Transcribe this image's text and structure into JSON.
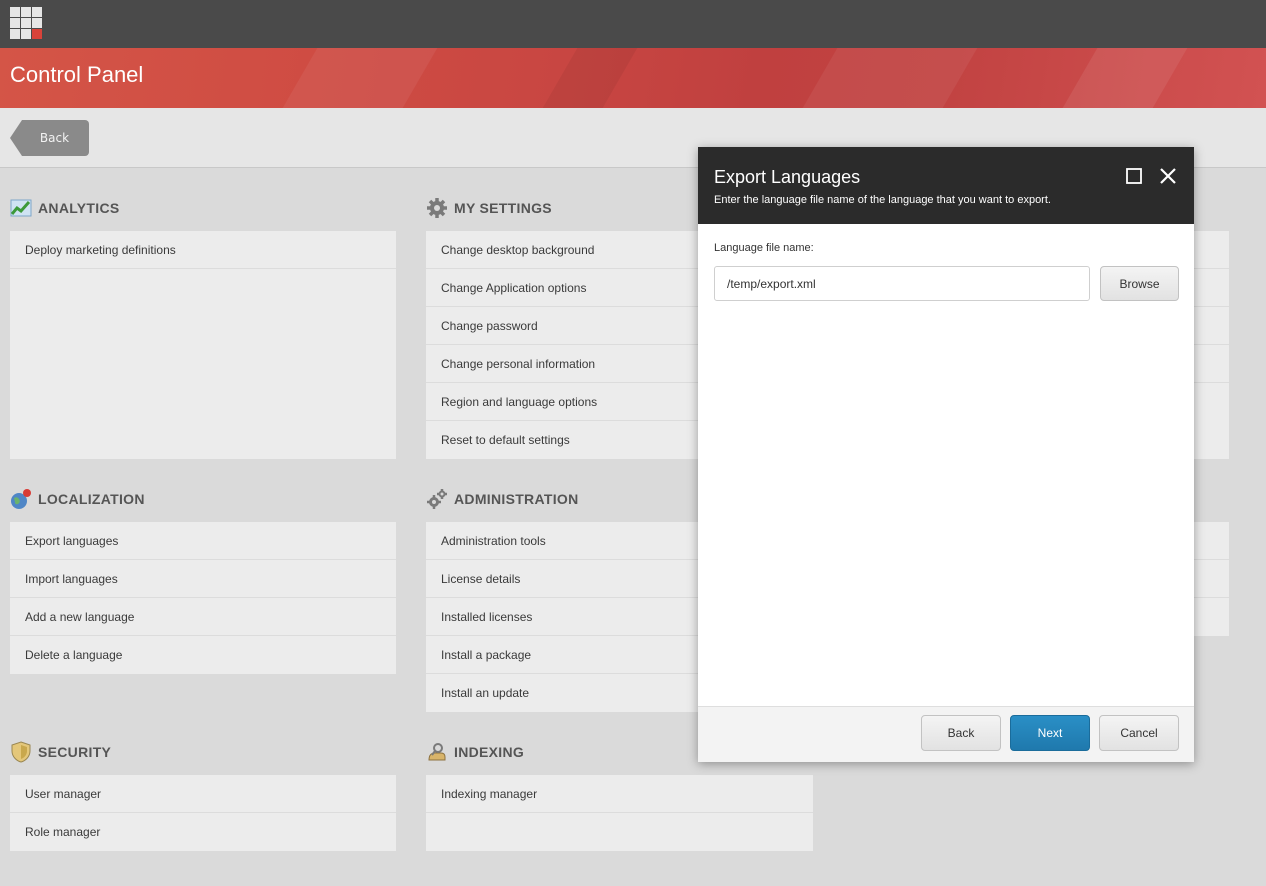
{
  "header": {
    "title": "Control Panel"
  },
  "toolbar": {
    "back_label": "Back"
  },
  "sections": {
    "analytics": {
      "title": "ANALYTICS",
      "icon": "analytics-chart-icon",
      "items": [
        "Deploy marketing definitions"
      ]
    },
    "my_settings": {
      "title": "MY SETTINGS",
      "icon": "gear-icon",
      "items": [
        "Change desktop background",
        "Change Application options",
        "Change password",
        "Change personal information",
        "Region and language options",
        "Reset to default settings"
      ]
    },
    "localization": {
      "title": "LOCALIZATION",
      "icon": "globe-icon",
      "items": [
        "Export languages",
        "Import languages",
        "Add a new language",
        "Delete a language"
      ]
    },
    "administration": {
      "title": "ADMINISTRATION",
      "icon": "gears-icon",
      "items": [
        "Administration tools",
        "License details",
        "Installed licenses",
        "Install a package",
        "Install an update"
      ]
    },
    "security": {
      "title": "SECURITY",
      "icon": "shield-icon",
      "items": [
        "User manager",
        "Role manager"
      ]
    },
    "indexing": {
      "title": "INDEXING",
      "icon": "indexing-icon",
      "items": [
        "Indexing manager"
      ]
    }
  },
  "dialog": {
    "title": "Export Languages",
    "subtitle": "Enter the language file name of the language that you want to export.",
    "field_label": "Language file name:",
    "field_value": "/temp/export.xml",
    "browse_label": "Browse",
    "back_label": "Back",
    "next_label": "Next",
    "cancel_label": "Cancel"
  },
  "colors": {
    "header_red": "#c8463f",
    "topbar": "#4a4a4a",
    "dialog_header": "#2b2b2b",
    "primary_button": "#1f79ad"
  }
}
